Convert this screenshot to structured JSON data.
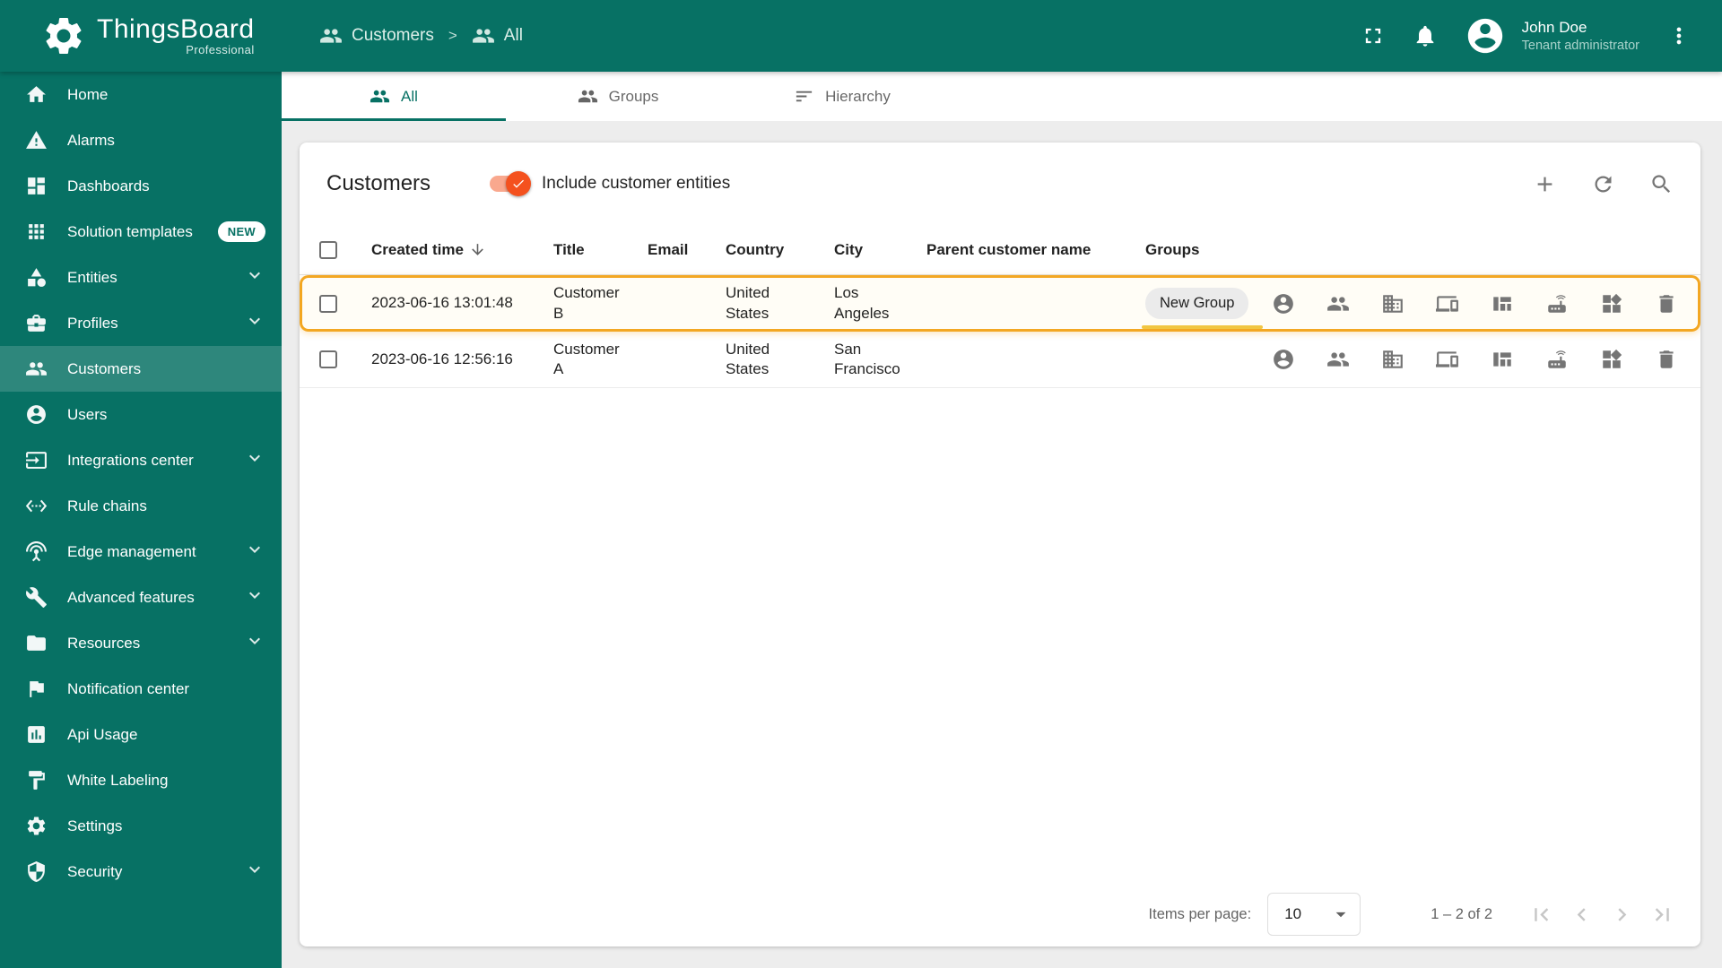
{
  "brand": {
    "title": "ThingsBoard",
    "subtitle": "Professional"
  },
  "breadcrumb": {
    "separator": ">",
    "items": [
      {
        "label": "Customers",
        "icon": "customers-icon"
      },
      {
        "label": "All",
        "icon": "group-icon"
      }
    ]
  },
  "topbar": {
    "user_name": "John Doe",
    "user_role": "Tenant administrator",
    "icons": [
      "fullscreen-icon",
      "notifications-bell-icon",
      "avatar-icon",
      "more-vertical-icon"
    ]
  },
  "sidebar": {
    "items": [
      {
        "label": "Home",
        "icon": "home-icon"
      },
      {
        "label": "Alarms",
        "icon": "alarms-warning-icon"
      },
      {
        "label": "Dashboards",
        "icon": "dashboards-icon"
      },
      {
        "label": "Solution templates",
        "icon": "solution-templates-icon",
        "badge": "NEW"
      },
      {
        "label": "Entities",
        "icon": "entities-icon",
        "expandable": true
      },
      {
        "label": "Profiles",
        "icon": "profiles-icon",
        "expandable": true
      },
      {
        "label": "Customers",
        "icon": "customers-icon",
        "active": true
      },
      {
        "label": "Users",
        "icon": "users-icon"
      },
      {
        "label": "Integrations center",
        "icon": "integrations-icon",
        "expandable": true
      },
      {
        "label": "Rule chains",
        "icon": "rule-chains-icon"
      },
      {
        "label": "Edge management",
        "icon": "edge-management-icon",
        "expandable": true
      },
      {
        "label": "Advanced features",
        "icon": "advanced-features-icon",
        "expandable": true
      },
      {
        "label": "Resources",
        "icon": "resources-icon",
        "expandable": true
      },
      {
        "label": "Notification center",
        "icon": "notification-center-icon"
      },
      {
        "label": "Api Usage",
        "icon": "api-usage-icon"
      },
      {
        "label": "White Labeling",
        "icon": "white-labeling-icon"
      },
      {
        "label": "Settings",
        "icon": "settings-gear-icon"
      },
      {
        "label": "Security",
        "icon": "security-shield-icon",
        "expandable": true
      }
    ]
  },
  "tabs": [
    {
      "label": "All",
      "icon": "people-icon",
      "active": true
    },
    {
      "label": "Groups",
      "icon": "people-icon"
    },
    {
      "label": "Hierarchy",
      "icon": "hierarchy-icon"
    }
  ],
  "table_card": {
    "title": "Customers",
    "toggle_label": "Include customer entities",
    "toggle_on": true,
    "columns": {
      "created_time": "Created time",
      "title": "Title",
      "email": "Email",
      "country": "Country",
      "city": "City",
      "parent": "Parent customer name",
      "groups": "Groups"
    },
    "row_action_icons": [
      "manage-users-icon",
      "manage-customers-icon",
      "manage-assets-icon",
      "manage-devices-icon",
      "manage-entity-views-icon",
      "manage-edges-icon",
      "manage-dashboards-icon",
      "delete-icon"
    ],
    "rows": [
      {
        "created_time": "2023-06-16 13:01:48",
        "title": "Customer B",
        "email": "",
        "country": "United States",
        "city": "Los Angeles",
        "parent": "",
        "group_chip": "New Group",
        "highlighted": true
      },
      {
        "created_time": "2023-06-16 12:56:16",
        "title": "Customer A",
        "email": "",
        "country": "United States",
        "city": "San Francisco",
        "parent": "",
        "group_chip": ""
      }
    ],
    "pagination": {
      "items_per_page_label": "Items per page:",
      "items_per_page_value": "10",
      "range_label": "1 – 2 of 2"
    }
  },
  "colors": {
    "primary": "#077164",
    "accent": "#f4511e",
    "highlight": "#f3a722"
  }
}
